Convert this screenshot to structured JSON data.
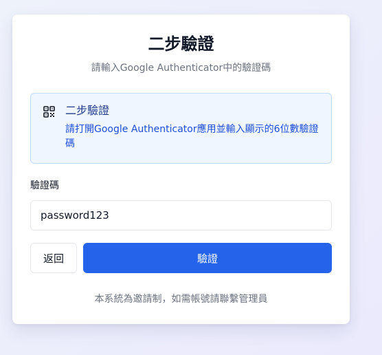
{
  "page": {
    "title": "二步驗證",
    "subtitle": "請輸入Google Authenticator中的驗證碼"
  },
  "info": {
    "icon": "qr-code-icon",
    "title": "二步驗證",
    "text": "請打開Google Authenticator應用並輸入顯示的6位數驗證碼"
  },
  "form": {
    "code_label": "驗證碼",
    "code_value": "password123",
    "back_label": "返回",
    "verify_label": "驗證"
  },
  "footer": {
    "note": "本系統為邀請制，如需帳號請聯繫管理員"
  },
  "colors": {
    "primary": "#2563eb",
    "info_bg": "#eff6ff",
    "info_border": "#bfdbfe",
    "info_text": "#1d4ed8"
  }
}
